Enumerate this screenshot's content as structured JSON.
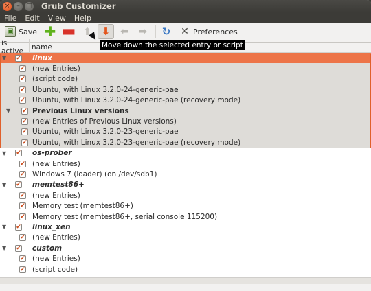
{
  "window": {
    "title": "Grub Customizer"
  },
  "menu": [
    "File",
    "Edit",
    "View",
    "Help"
  ],
  "toolbar": {
    "save_label": "Save",
    "preferences_label": "Preferences",
    "tooltip": "Move down the selected entry or script"
  },
  "columns": {
    "active": "is active",
    "name": "name"
  },
  "rows": [
    {
      "label": "linux",
      "kind": "top",
      "style": "title-it",
      "checked": true,
      "selected": true,
      "expander": true
    },
    {
      "label": "(new Entries)",
      "kind": "child",
      "checked": true,
      "group": true
    },
    {
      "label": "(script code)",
      "kind": "child",
      "checked": true,
      "group": true
    },
    {
      "label": "Ubuntu, with Linux 3.2.0-24-generic-pae",
      "kind": "child",
      "checked": true,
      "group": true
    },
    {
      "label": "Ubuntu, with Linux 3.2.0-24-generic-pae (recovery mode)",
      "kind": "child",
      "checked": true,
      "group": true
    },
    {
      "label": "Previous Linux versions",
      "kind": "sub",
      "style": "bold",
      "checked": true,
      "group": true,
      "expander": true
    },
    {
      "label": "(new Entries of Previous Linux versions)",
      "kind": "subchild",
      "checked": true,
      "group": true
    },
    {
      "label": "Ubuntu, with Linux 3.2.0-23-generic-pae",
      "kind": "subchild",
      "checked": true,
      "group": true
    },
    {
      "label": "Ubuntu, with Linux 3.2.0-23-generic-pae (recovery mode)",
      "kind": "subchild",
      "checked": true,
      "group": true
    },
    {
      "label": "os-prober",
      "kind": "top",
      "style": "title-it",
      "checked": true,
      "expander": true
    },
    {
      "label": "(new Entries)",
      "kind": "child",
      "checked": true
    },
    {
      "label": "Windows 7 (loader) (on /dev/sdb1)",
      "kind": "child",
      "checked": true
    },
    {
      "label": "memtest86+",
      "kind": "top",
      "style": "title-it",
      "checked": true,
      "expander": true
    },
    {
      "label": "(new Entries)",
      "kind": "child",
      "checked": true
    },
    {
      "label": "Memory test (memtest86+)",
      "kind": "child",
      "checked": true
    },
    {
      "label": "Memory test (memtest86+, serial console 115200)",
      "kind": "child",
      "checked": true
    },
    {
      "label": "linux_xen",
      "kind": "top",
      "style": "title-it",
      "checked": true,
      "expander": true
    },
    {
      "label": "(new Entries)",
      "kind": "child",
      "checked": true
    },
    {
      "label": "custom",
      "kind": "top",
      "style": "title-it",
      "checked": true,
      "expander": true
    },
    {
      "label": "(new Entries)",
      "kind": "child",
      "checked": true
    },
    {
      "label": "(script code)",
      "kind": "child",
      "checked": true
    }
  ],
  "icons": {
    "save": "disk-icon",
    "add": "plus-icon",
    "remove": "minus-icon",
    "up": "arrow-up-icon",
    "down": "arrow-down-icon",
    "back": "arrow-left-icon",
    "forward": "arrow-right-icon",
    "reload": "reload-icon",
    "preferences": "wrench-screwdriver-icon"
  },
  "colors": {
    "selection": "#ed7448",
    "titlebar": "#3c3b37",
    "check": "#c94a1a"
  }
}
